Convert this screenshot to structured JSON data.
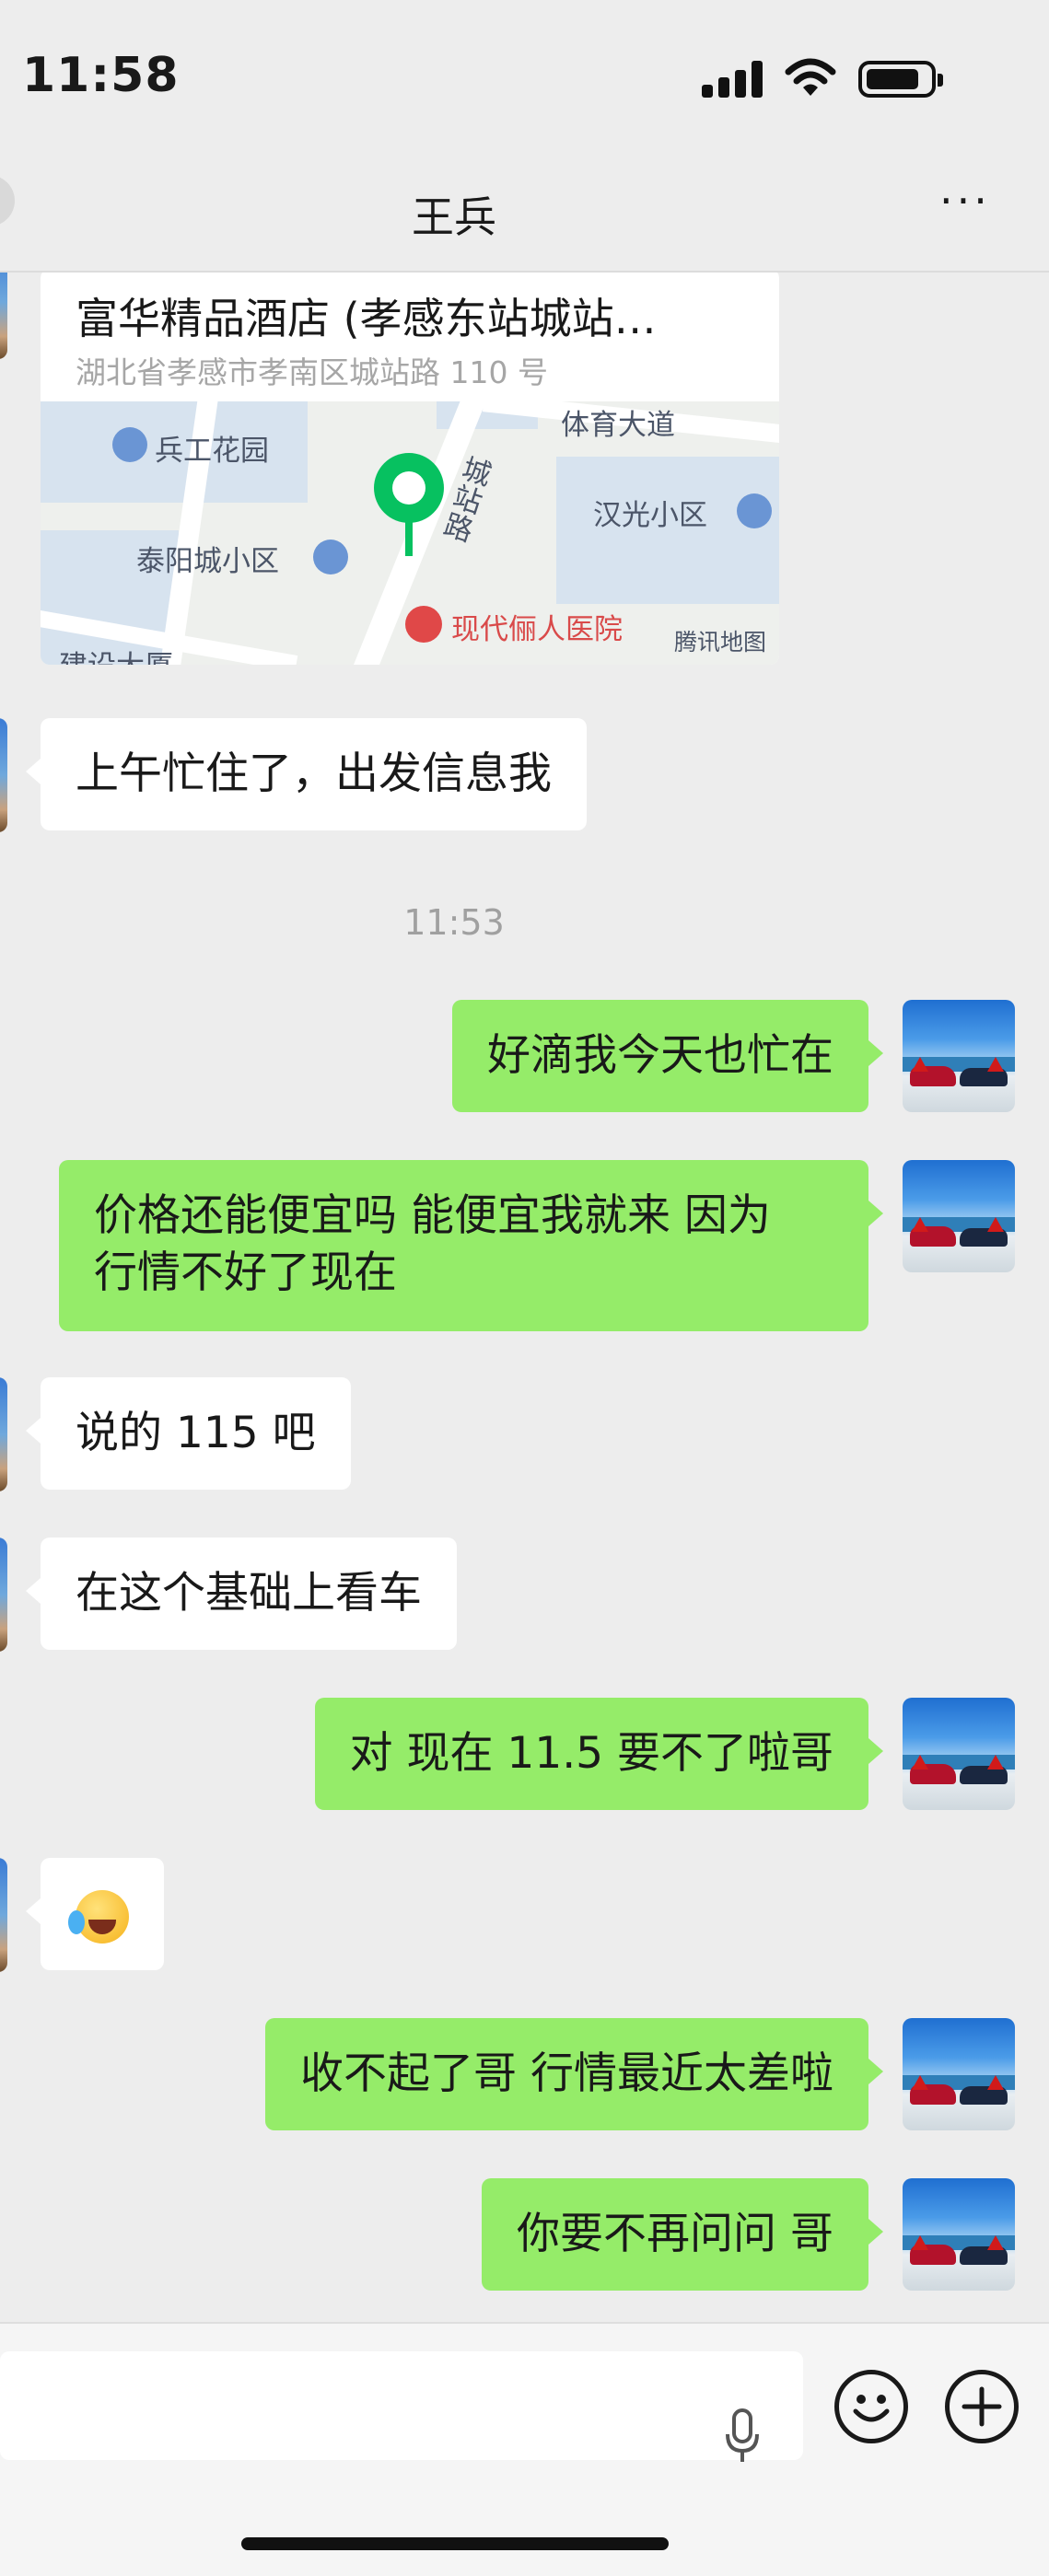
{
  "status_bar": {
    "time": "11:58"
  },
  "header": {
    "title": "王兵",
    "more_label": "···"
  },
  "location_card": {
    "title": "富华精品酒店 (孝感东站城站…",
    "address": "湖北省孝感市孝南区城站路 110 号",
    "map_labels": {
      "road_top": "体育大道",
      "road_vertical": "城站路",
      "poi_1": "兵工花园",
      "poi_2": "汉光小区",
      "poi_3": "泰阳城小区",
      "poi_4": "现代俪人医院",
      "poi_5": "建设大厦",
      "brand": "腾讯地图"
    }
  },
  "messages": [
    {
      "side": "in",
      "text": "上午忙住了，出发信息我"
    },
    {
      "side": "time",
      "text": "11:53"
    },
    {
      "side": "out",
      "text": "好滴我今天也忙在"
    },
    {
      "side": "out",
      "line1": "价格还能便宜吗 能便宜我就来 因为",
      "line2": "行情不好了现在"
    },
    {
      "side": "in",
      "text": "说的 115 吧"
    },
    {
      "side": "in",
      "text": "在这个基础上看车"
    },
    {
      "side": "out",
      "text": "对 现在 11.5 要不了啦哥"
    },
    {
      "side": "in",
      "emoji": "crying-laughing"
    },
    {
      "side": "out",
      "text": "收不起了哥 行情最近太差啦"
    },
    {
      "side": "out",
      "text": "你要不再问问 哥"
    }
  ],
  "colors": {
    "background": "#ededed",
    "outgoing_bubble": "#95ec69",
    "incoming_bubble": "#ffffff",
    "accent": "#07c160"
  },
  "icons": [
    "signal-icon",
    "wifi-icon",
    "battery-icon",
    "more-icon",
    "location-pin-icon",
    "voice-icon",
    "emoji-icon",
    "plus-icon"
  ]
}
